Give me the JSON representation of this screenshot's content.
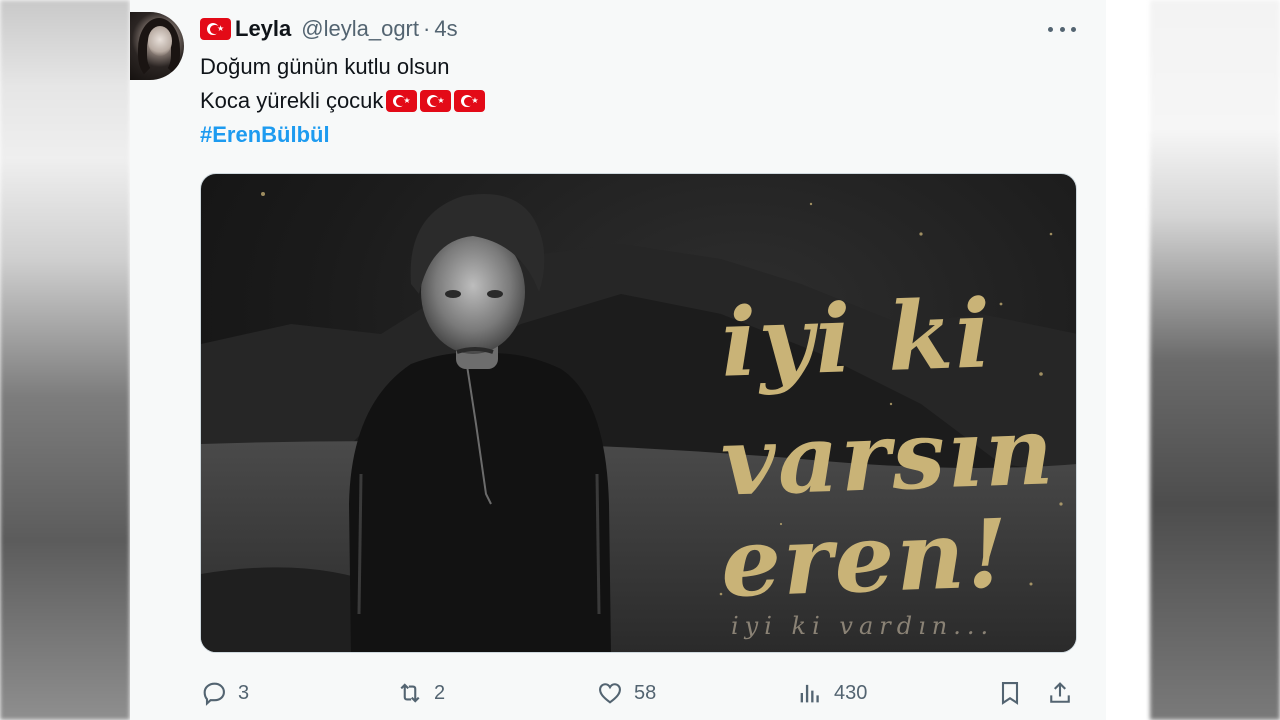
{
  "tweet": {
    "display_name": "Leyla",
    "handle": "@leyla_ogrt",
    "separator": "·",
    "time": "4s",
    "lines": [
      "Doğum günün kutlu olsun",
      "Koca yürekli çocuk"
    ],
    "hashtag": "#ErenBülbül",
    "emoji_flags_count": 3
  },
  "media": {
    "script_lines": [
      "iyi ki",
      "varsın",
      "eren!"
    ],
    "subtitle": "iyi ki vardın..."
  },
  "actions": {
    "replies": "3",
    "retweets": "2",
    "likes": "58",
    "views": "430"
  },
  "icons": {
    "reply": "reply-bubble-icon",
    "retweet": "retweet-icon",
    "like": "heart-icon",
    "views": "analytics-bars-icon",
    "bookmark": "bookmark-icon",
    "share": "share-upload-icon",
    "more": "more-dots-icon",
    "flag": "turkish-flag-icon"
  },
  "colors": {
    "text": "#0f1419",
    "muted": "#536471",
    "link": "#1d9bf0",
    "flag_red": "#e30a17",
    "script_gold": "#c9b377"
  }
}
